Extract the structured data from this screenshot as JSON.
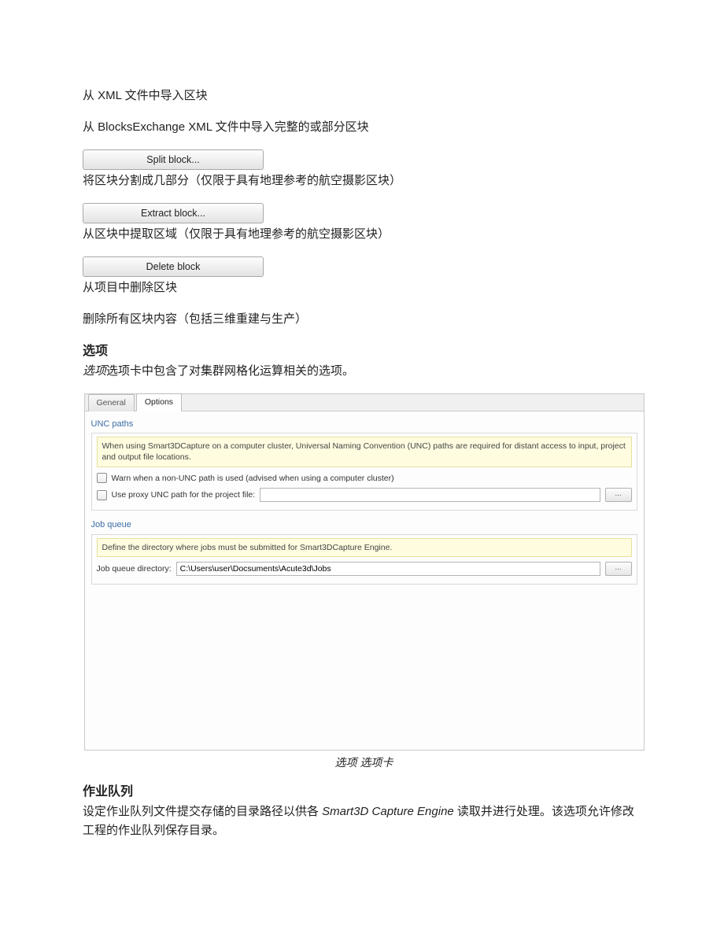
{
  "p_import_xml": "从 XML 文件中导入区块",
  "p_import_bex": "从 BlocksExchange XML 文件中导入完整的或部分区块",
  "btn_split": "Split block...",
  "p_split_desc": "将区块分割成几部分（仅限于具有地理参考的航空摄影区块）",
  "btn_extract": "Extract block...",
  "p_extract_desc": "从区块中提取区域（仅限于具有地理参考的航空摄影区块）",
  "btn_delete": "Delete block",
  "p_delete_desc": "从项目中删除区块",
  "p_delete_all": "删除所有区块内容（包括三维重建与生产）",
  "h_options": "选项",
  "p_options_intro_prefix": "选项",
  "p_options_intro_rest": "选项卡中包含了对集群网格化运算相关的选项。",
  "panel": {
    "tab_general": "General",
    "tab_options": "Options",
    "unc": {
      "title": "UNC paths",
      "info": "When using Smart3DCapture on a computer cluster, Universal Naming Convention (UNC) paths are required for distant access to input, project and output file locations.",
      "warn_label": "Warn when a non-UNC path is used (advised when using a computer cluster)",
      "proxy_label": "Use proxy UNC path for the project file:",
      "proxy_value": "",
      "browse": "..."
    },
    "jobq": {
      "title": "Job queue",
      "info": "Define the directory where jobs must be submitted for Smart3DCapture Engine.",
      "dir_label": "Job queue directory:",
      "dir_value": "C:\\Users\\user\\Docsuments\\Acute3d\\Jobs",
      "browse": "..."
    }
  },
  "caption": "选项 选项卡",
  "h_jobqueue": "作业队列",
  "p_jobqueue_1a": "设定作业队列文件提交存储的目录路径以供各 ",
  "p_jobqueue_1b": "Smart3D Capture Engine",
  "p_jobqueue_1c": "  读取并进行处理。该选项允许修改工程的作业队列保存目录。"
}
